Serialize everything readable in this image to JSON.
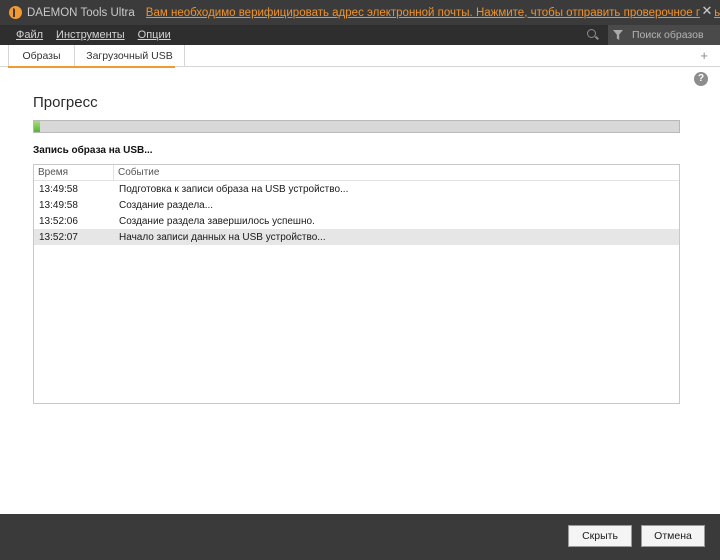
{
  "app": {
    "title": "DAEMON Tools Ultra",
    "notice": "Вам необходимо верифицировать адрес электронной почты. Нажмите, чтобы отправить проверочное письмо",
    "accent_color": "#f29a2e"
  },
  "menu": {
    "items": [
      "Файл",
      "Инструменты",
      "Опции"
    ],
    "search_placeholder": "Поиск образов"
  },
  "tabs": [
    {
      "label": "Образы"
    },
    {
      "label": "Загрузочный USB"
    }
  ],
  "progress": {
    "heading": "Прогресс",
    "fraction": 0.01,
    "status": "Запись образа на USB..."
  },
  "log": {
    "columns": {
      "time": "Время",
      "event": "Событие"
    },
    "rows": [
      {
        "time": "13:49:58",
        "event": "Подготовка к записи образа на USB устройство..."
      },
      {
        "time": "13:49:58",
        "event": "Создание раздела..."
      },
      {
        "time": "13:52:06",
        "event": "Создание раздела завершилось успешно."
      },
      {
        "time": "13:52:07",
        "event": "Начало записи данных на USB устройство..."
      }
    ],
    "selected_index": 3
  },
  "buttons": {
    "hide": "Скрыть",
    "cancel": "Отмена"
  }
}
